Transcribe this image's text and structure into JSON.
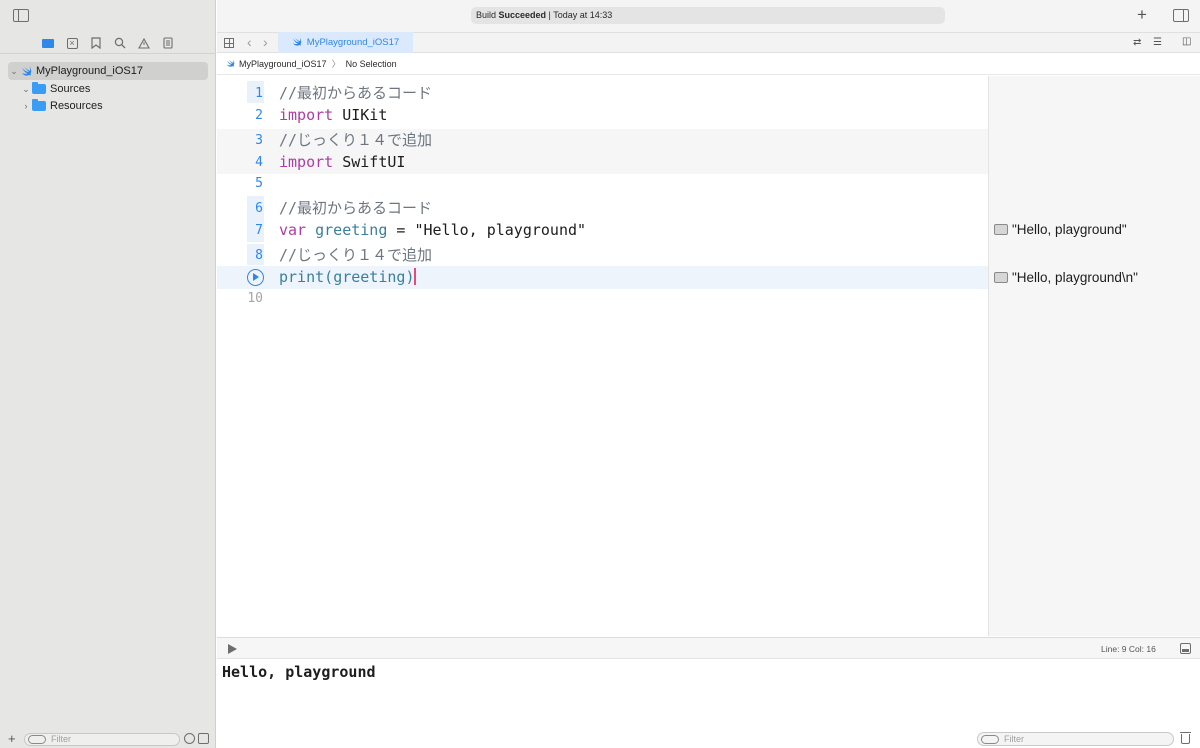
{
  "toolbar": {
    "status_prefix": "Build ",
    "status_bold": "Succeeded",
    "status_suffix": " | Today at 14:33",
    "add_icon": "plus-icon",
    "inspector_icon": "inspector-toggle-icon"
  },
  "navigator": {
    "tabs": [
      "folder-icon",
      "source-control-icon",
      "bookmark-icon",
      "search-icon",
      "issue-icon",
      "report-icon"
    ],
    "tree": [
      {
        "label": "MyPlayground_iOS17",
        "expanded": true,
        "selected": true,
        "icon": "swift-icon"
      },
      {
        "label": "Sources",
        "expanded": true,
        "icon": "folder-icon"
      },
      {
        "label": "Resources",
        "expanded": false,
        "icon": "folder-icon"
      }
    ],
    "filter_placeholder": "Filter"
  },
  "tabbar": {
    "active_tab": "MyPlayground_iOS17"
  },
  "jumpbar": {
    "file": "MyPlayground_iOS17",
    "selection": "No Selection"
  },
  "editor": {
    "lines": [
      {
        "n": "1",
        "text": "//最初からあるコード"
      },
      {
        "n": "2",
        "kw": "import",
        "rest": " UIKit"
      },
      {
        "n": "3",
        "text": "//じっくり１４で追加"
      },
      {
        "n": "4",
        "kw": "import",
        "rest": " SwiftUI"
      },
      {
        "n": "5"
      },
      {
        "n": "6",
        "text": "//最初からあるコード"
      },
      {
        "n": "7",
        "kw": "var",
        "name": "greeting",
        "rest": " = \"Hello, playground\""
      },
      {
        "n": "8",
        "text": "//じっくり１４で追加"
      },
      {
        "n": "9",
        "fn": "print(",
        "arg": "greeting",
        "close": ")"
      },
      {
        "n": "10"
      }
    ]
  },
  "results": {
    "line7": "\"Hello, playground\"",
    "line9": "\"Hello, playground\\n\""
  },
  "debug": {
    "line_col": "Line: 9  Col: 16",
    "console_output": "Hello, playground",
    "filter_placeholder": "Filter"
  },
  "colors": {
    "accent": "#2f87ea",
    "keyword": "#ad3da4",
    "identifier": "#3b7f9c",
    "comment": "#6c7680",
    "caret": "#e8497a"
  }
}
